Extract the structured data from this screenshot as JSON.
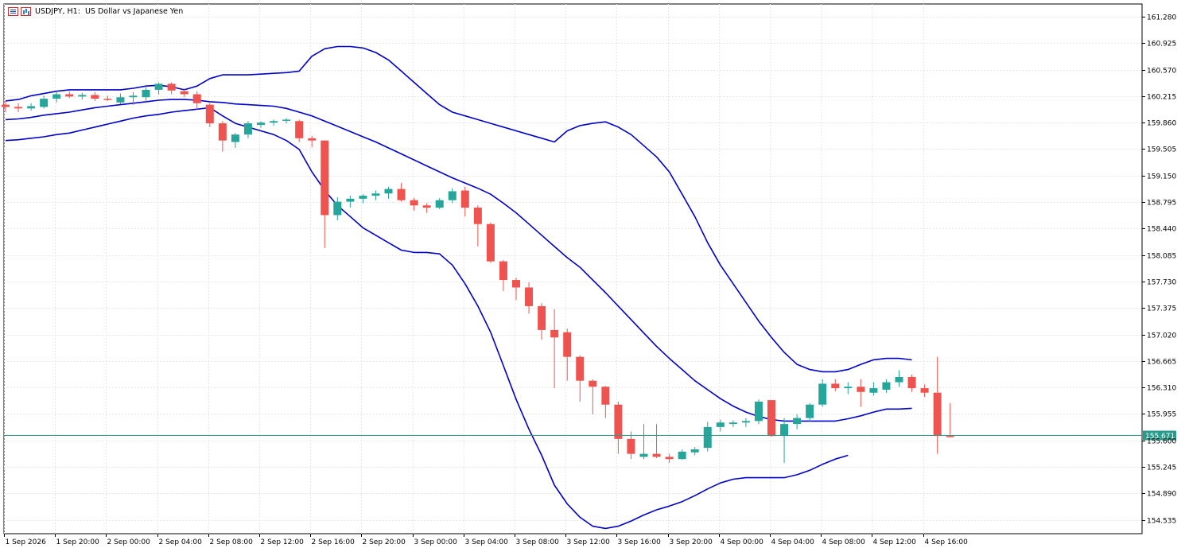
{
  "header": {
    "symbol": "USDJPY",
    "timeframe": "H1",
    "description": "US Dollar vs Japanese Yen",
    "icons": [
      "list-icon",
      "bar-chart-icon"
    ]
  },
  "colors": {
    "bull": "#26a69a",
    "bear": "#ef5350",
    "bands": "#0000cc",
    "price_line": "#2a9a8a",
    "grid": "#e6e6e6",
    "axis": "#000000"
  },
  "chart_data": {
    "type": "candlestick",
    "ylim": [
      154.35,
      161.45
    ],
    "yticks": [
      "161.280",
      "160.925",
      "160.570",
      "160.215",
      "159.860",
      "159.505",
      "159.150",
      "158.795",
      "158.440",
      "158.085",
      "157.730",
      "157.375",
      "157.020",
      "156.665",
      "156.310",
      "155.955",
      "155.600",
      "155.245",
      "154.890",
      "154.535"
    ],
    "xticks": [
      "1 Sep 2026",
      "1 Sep 20:00",
      "2 Sep 00:00",
      "2 Sep 04:00",
      "2 Sep 08:00",
      "2 Sep 12:00",
      "2 Sep 16:00",
      "2 Sep 20:00",
      "3 Sep 00:00",
      "3 Sep 04:00",
      "3 Sep 08:00",
      "3 Sep 12:00",
      "3 Sep 16:00",
      "3 Sep 20:00",
      "4 Sep 00:00",
      "4 Sep 04:00",
      "4 Sep 08:00",
      "4 Sep 12:00",
      "4 Sep 16:00"
    ],
    "candles": [
      {
        "o": 160.1,
        "h": 160.15,
        "l": 160.0,
        "c": 160.07
      },
      {
        "o": 160.07,
        "h": 160.12,
        "l": 160.0,
        "c": 160.05
      },
      {
        "o": 160.05,
        "h": 160.12,
        "l": 160.02,
        "c": 160.08
      },
      {
        "o": 160.07,
        "h": 160.22,
        "l": 160.05,
        "c": 160.18
      },
      {
        "o": 160.18,
        "h": 160.28,
        "l": 160.13,
        "c": 160.24
      },
      {
        "o": 160.24,
        "h": 160.28,
        "l": 160.19,
        "c": 160.21
      },
      {
        "o": 160.21,
        "h": 160.26,
        "l": 160.17,
        "c": 160.23
      },
      {
        "o": 160.23,
        "h": 160.27,
        "l": 160.15,
        "c": 160.18
      },
      {
        "o": 160.18,
        "h": 160.22,
        "l": 160.15,
        "c": 160.17
      },
      {
        "o": 160.13,
        "h": 160.25,
        "l": 160.11,
        "c": 160.2
      },
      {
        "o": 160.2,
        "h": 160.27,
        "l": 160.1,
        "c": 160.22
      },
      {
        "o": 160.2,
        "h": 160.35,
        "l": 160.12,
        "c": 160.3
      },
      {
        "o": 160.3,
        "h": 160.4,
        "l": 160.24,
        "c": 160.38
      },
      {
        "o": 160.38,
        "h": 160.4,
        "l": 160.24,
        "c": 160.29
      },
      {
        "o": 160.28,
        "h": 160.32,
        "l": 160.2,
        "c": 160.24
      },
      {
        "o": 160.24,
        "h": 160.28,
        "l": 160.03,
        "c": 160.12
      },
      {
        "o": 160.1,
        "h": 160.12,
        "l": 159.8,
        "c": 159.85
      },
      {
        "o": 159.85,
        "h": 159.88,
        "l": 159.47,
        "c": 159.62
      },
      {
        "o": 159.6,
        "h": 159.72,
        "l": 159.52,
        "c": 159.7
      },
      {
        "o": 159.7,
        "h": 159.88,
        "l": 159.65,
        "c": 159.85
      },
      {
        "o": 159.83,
        "h": 159.88,
        "l": 159.79,
        "c": 159.86
      },
      {
        "o": 159.86,
        "h": 159.9,
        "l": 159.82,
        "c": 159.88
      },
      {
        "o": 159.89,
        "h": 159.92,
        "l": 159.85,
        "c": 159.9
      },
      {
        "o": 159.88,
        "h": 159.9,
        "l": 159.6,
        "c": 159.65
      },
      {
        "o": 159.65,
        "h": 159.68,
        "l": 159.53,
        "c": 159.62
      },
      {
        "o": 159.62,
        "h": 159.62,
        "l": 158.18,
        "c": 158.62
      },
      {
        "o": 158.62,
        "h": 158.86,
        "l": 158.55,
        "c": 158.8
      },
      {
        "o": 158.8,
        "h": 158.88,
        "l": 158.72,
        "c": 158.84
      },
      {
        "o": 158.84,
        "h": 158.9,
        "l": 158.78,
        "c": 158.88
      },
      {
        "o": 158.88,
        "h": 158.95,
        "l": 158.82,
        "c": 158.91
      },
      {
        "o": 158.91,
        "h": 159.0,
        "l": 158.84,
        "c": 158.97
      },
      {
        "o": 158.97,
        "h": 159.05,
        "l": 158.8,
        "c": 158.82
      },
      {
        "o": 158.82,
        "h": 158.85,
        "l": 158.68,
        "c": 158.75
      },
      {
        "o": 158.75,
        "h": 158.78,
        "l": 158.65,
        "c": 158.72
      },
      {
        "o": 158.72,
        "h": 158.85,
        "l": 158.7,
        "c": 158.82
      },
      {
        "o": 158.82,
        "h": 158.98,
        "l": 158.78,
        "c": 158.94
      },
      {
        "o": 158.95,
        "h": 159.0,
        "l": 158.6,
        "c": 158.72
      },
      {
        "o": 158.72,
        "h": 158.75,
        "l": 158.2,
        "c": 158.5
      },
      {
        "o": 158.5,
        "h": 158.52,
        "l": 157.98,
        "c": 158.0
      },
      {
        "o": 158.0,
        "h": 158.02,
        "l": 157.6,
        "c": 157.75
      },
      {
        "o": 157.75,
        "h": 157.78,
        "l": 157.48,
        "c": 157.65
      },
      {
        "o": 157.65,
        "h": 157.72,
        "l": 157.3,
        "c": 157.4
      },
      {
        "o": 157.4,
        "h": 157.44,
        "l": 156.95,
        "c": 157.08
      },
      {
        "o": 157.08,
        "h": 157.36,
        "l": 156.3,
        "c": 156.98
      },
      {
        "o": 157.05,
        "h": 157.1,
        "l": 156.4,
        "c": 156.72
      },
      {
        "o": 156.72,
        "h": 156.74,
        "l": 156.12,
        "c": 156.4
      },
      {
        "o": 156.4,
        "h": 156.42,
        "l": 155.95,
        "c": 156.32
      },
      {
        "o": 156.32,
        "h": 156.33,
        "l": 155.9,
        "c": 156.08
      },
      {
        "o": 156.08,
        "h": 156.12,
        "l": 155.42,
        "c": 155.62
      },
      {
        "o": 155.62,
        "h": 155.72,
        "l": 155.35,
        "c": 155.42
      },
      {
        "o": 155.38,
        "h": 155.82,
        "l": 155.35,
        "c": 155.42
      },
      {
        "o": 155.42,
        "h": 155.82,
        "l": 155.36,
        "c": 155.38
      },
      {
        "o": 155.38,
        "h": 155.42,
        "l": 155.3,
        "c": 155.35
      },
      {
        "o": 155.35,
        "h": 155.48,
        "l": 155.34,
        "c": 155.45
      },
      {
        "o": 155.44,
        "h": 155.51,
        "l": 155.4,
        "c": 155.48
      },
      {
        "o": 155.5,
        "h": 155.85,
        "l": 155.45,
        "c": 155.78
      },
      {
        "o": 155.78,
        "h": 155.88,
        "l": 155.72,
        "c": 155.84
      },
      {
        "o": 155.82,
        "h": 155.87,
        "l": 155.78,
        "c": 155.84
      },
      {
        "o": 155.84,
        "h": 155.9,
        "l": 155.78,
        "c": 155.86
      },
      {
        "o": 155.86,
        "h": 156.15,
        "l": 155.82,
        "c": 156.12
      },
      {
        "o": 156.14,
        "h": 156.14,
        "l": 155.65,
        "c": 155.66
      },
      {
        "o": 155.66,
        "h": 155.9,
        "l": 155.3,
        "c": 155.82
      },
      {
        "o": 155.82,
        "h": 155.95,
        "l": 155.75,
        "c": 155.9
      },
      {
        "o": 155.9,
        "h": 156.1,
        "l": 155.85,
        "c": 156.08
      },
      {
        "o": 156.08,
        "h": 156.42,
        "l": 156.05,
        "c": 156.36
      },
      {
        "o": 156.36,
        "h": 156.42,
        "l": 156.26,
        "c": 156.3
      },
      {
        "o": 156.3,
        "h": 156.38,
        "l": 156.22,
        "c": 156.32
      },
      {
        "o": 156.32,
        "h": 156.42,
        "l": 156.05,
        "c": 156.25
      },
      {
        "o": 156.24,
        "h": 156.38,
        "l": 156.2,
        "c": 156.3
      },
      {
        "o": 156.28,
        "h": 156.42,
        "l": 156.24,
        "c": 156.38
      },
      {
        "o": 156.38,
        "h": 156.54,
        "l": 156.32,
        "c": 156.45
      },
      {
        "o": 156.45,
        "h": 156.48,
        "l": 156.25,
        "c": 156.3
      },
      {
        "o": 156.3,
        "h": 156.35,
        "l": 156.18,
        "c": 156.24
      },
      {
        "o": 156.24,
        "h": 156.72,
        "l": 155.42,
        "c": 155.66
      },
      {
        "o": 155.66,
        "h": 156.1,
        "l": 155.64,
        "c": 155.65
      }
    ],
    "bands": {
      "upper": [
        160.15,
        160.17,
        160.22,
        160.25,
        160.28,
        160.3,
        160.3,
        160.3,
        160.3,
        160.3,
        160.32,
        160.35,
        160.36,
        160.34,
        160.3,
        160.35,
        160.45,
        160.5,
        160.5,
        160.5,
        160.51,
        160.52,
        160.53,
        160.55,
        160.75,
        160.85,
        160.88,
        160.88,
        160.86,
        160.8,
        160.7,
        160.55,
        160.4,
        160.25,
        160.1,
        160.0,
        159.95,
        159.9,
        159.85,
        159.8,
        159.75,
        159.7,
        159.65,
        159.6,
        159.75,
        159.82,
        159.85,
        159.87,
        159.8,
        159.7,
        159.55,
        159.4,
        159.2,
        158.9,
        158.6,
        158.25,
        157.95,
        157.7,
        157.45,
        157.2,
        156.98,
        156.78,
        156.62,
        156.55,
        156.52,
        156.52,
        156.55,
        156.62,
        156.68,
        156.7,
        156.7,
        156.68
      ],
      "middle": [
        159.9,
        159.91,
        159.93,
        159.96,
        159.98,
        160.0,
        160.03,
        160.06,
        160.08,
        160.1,
        160.12,
        160.14,
        160.16,
        160.17,
        160.17,
        160.16,
        160.14,
        160.13,
        160.11,
        160.1,
        160.09,
        160.08,
        160.05,
        160.0,
        159.95,
        159.88,
        159.81,
        159.74,
        159.67,
        159.6,
        159.52,
        159.44,
        159.36,
        159.28,
        159.2,
        159.12,
        159.05,
        158.98,
        158.9,
        158.78,
        158.65,
        158.5,
        158.35,
        158.2,
        158.05,
        157.92,
        157.75,
        157.58,
        157.4,
        157.22,
        157.04,
        156.86,
        156.7,
        156.55,
        156.4,
        156.28,
        156.16,
        156.06,
        155.98,
        155.92,
        155.88,
        155.86,
        155.86,
        155.86,
        155.86,
        155.86,
        155.89,
        155.93,
        155.98,
        156.02,
        156.02,
        156.03
      ],
      "lower": [
        159.62,
        159.63,
        159.65,
        159.67,
        159.7,
        159.72,
        159.76,
        159.8,
        159.84,
        159.88,
        159.92,
        159.95,
        159.97,
        160.0,
        160.02,
        160.04,
        160.06,
        159.95,
        159.85,
        159.8,
        159.75,
        159.7,
        159.62,
        159.5,
        159.2,
        158.95,
        158.75,
        158.6,
        158.45,
        158.35,
        158.25,
        158.15,
        158.12,
        158.12,
        158.1,
        157.95,
        157.7,
        157.4,
        157.05,
        156.6,
        156.15,
        155.75,
        155.4,
        155.0,
        154.75,
        154.57,
        154.45,
        154.42,
        154.45,
        154.52,
        154.6,
        154.67,
        154.72,
        154.78,
        154.86,
        154.95,
        155.03,
        155.08,
        155.1,
        155.1,
        155.1,
        155.1,
        155.14,
        155.2,
        155.28,
        155.35,
        155.4
      ],
      "upper_start_index": 0,
      "middle_start_index": 0,
      "lower_start_index": 0
    },
    "current_price": 155.671,
    "current_price_label": "155.671"
  }
}
